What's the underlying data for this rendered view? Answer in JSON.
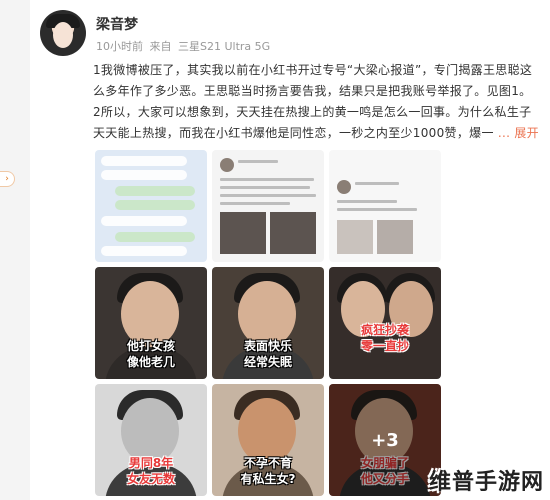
{
  "post": {
    "username": "梁音梦",
    "time": "10小时前",
    "source_prefix": "来自",
    "device": "三星S21 Ultra 5G",
    "text_lines": [
      "1我微博被压了，其实我以前在小红书开过专号“大梁心报道”，专门揭露王思聪这",
      "么多年作了多少恶。王思聪当时扬言要告我，结果只是把我账号举报了。见图1。",
      "2所以，大家可以想象到，天天挂在热搜上的黄一鸣是怎么一回事。为什么私生子",
      "天天能上热搜，而我在小红书爆他是同性恋，一秒之内至少1000赞，爆一"
    ],
    "expand_label": "... 展开"
  },
  "images": {
    "captions": {
      "t4": [
        "他打女孩",
        "像他老几"
      ],
      "t5": [
        "表面快乐",
        "经常失眠"
      ],
      "t6": [
        "疯狂抄袭",
        "零一直抄"
      ],
      "t7": [
        "男同8年",
        "女友无数"
      ],
      "t8": [
        "不孕不育",
        "有私生女?"
      ],
      "t9": [
        "女朋骗了",
        "他又分手"
      ]
    },
    "more_count": "+3"
  },
  "watermark": "维普手游网",
  "colors": {
    "accent": "#eb7350",
    "text": "#333333",
    "meta": "#999999"
  }
}
